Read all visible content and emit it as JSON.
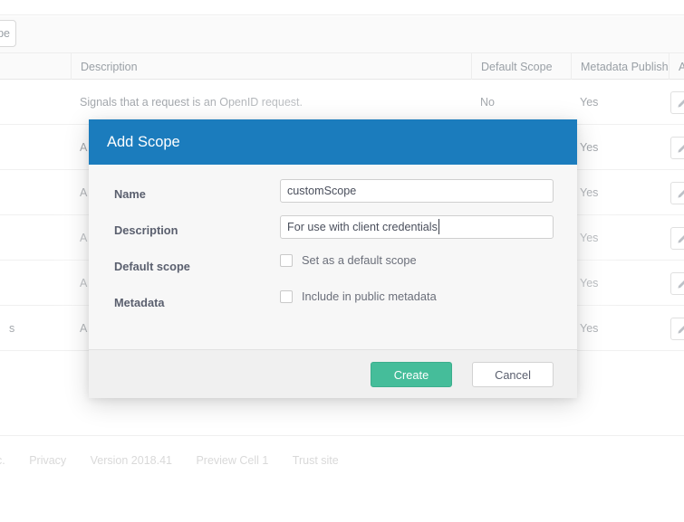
{
  "toolbar": {
    "add_scope_button_label": "pe"
  },
  "table": {
    "columns": [
      "",
      "Description",
      "Default Scope",
      "Metadata Publish",
      "Ac"
    ],
    "rows": [
      {
        "name": "",
        "description": "Signals that a request is an OpenID request.",
        "default_scope": "No",
        "metadata_publish": "Yes",
        "action_icon": "pencil-icon"
      },
      {
        "name": "",
        "description": "A",
        "default_scope": "",
        "metadata_publish": "Yes",
        "action_icon": "pencil-icon"
      },
      {
        "name": "",
        "description": "A",
        "default_scope": "",
        "metadata_publish": "Yes",
        "action_icon": "pencil-icon"
      },
      {
        "name": "",
        "description": "A",
        "default_scope": "",
        "metadata_publish": "Yes",
        "action_icon": "pencil-icon"
      },
      {
        "name": "",
        "description": "A",
        "default_scope": "",
        "metadata_publish": "Yes",
        "action_icon": "pencil-icon"
      },
      {
        "name": "s",
        "description": "A",
        "default_scope": "",
        "metadata_publish": "Yes",
        "action_icon": "pencil-icon"
      }
    ]
  },
  "page_footer": {
    "links": [
      "c.",
      "Privacy",
      "Version 2018.41",
      "Preview Cell 1",
      "Trust site"
    ]
  },
  "modal": {
    "title": "Add Scope",
    "fields": {
      "name": {
        "label": "Name",
        "value": "customScope",
        "placeholder": ""
      },
      "description": {
        "label": "Description",
        "value": "For use with client credentials",
        "placeholder": ""
      },
      "default_scope": {
        "label": "Default scope",
        "checkbox_label": "Set as a default scope",
        "checked": false
      },
      "metadata": {
        "label": "Metadata",
        "checkbox_label": "Include in public metadata",
        "checked": false
      }
    },
    "buttons": {
      "create": "Create",
      "cancel": "Cancel"
    }
  },
  "colors": {
    "header_blue": "#1b7cbd",
    "create_green": "#45bd9a",
    "modal_bg": "#f7f7f7",
    "footer_bg": "#f0f0f0"
  }
}
